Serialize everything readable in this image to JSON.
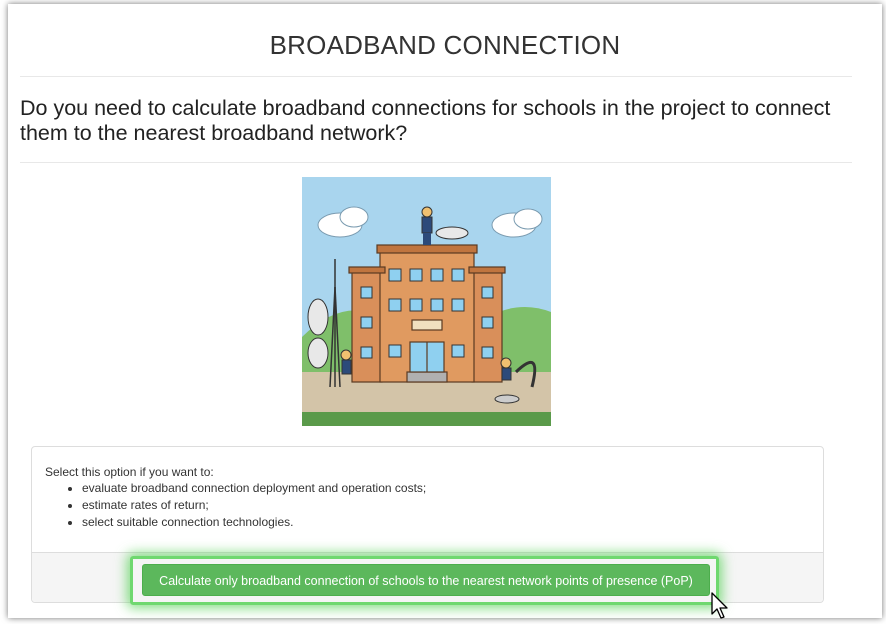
{
  "page": {
    "title": "BROADBAND CONNECTION",
    "question": "Do you need to calculate broadband connections for schools in the project to connect them to the nearest broadband network?"
  },
  "illustration": {
    "icon": "school-building-broadband-illustration"
  },
  "panel": {
    "intro": "Select this option if you want to:",
    "items": [
      "evaluate broadband connection deployment and operation costs;",
      "estimate rates of return;",
      "select suitable connection technologies."
    ]
  },
  "action": {
    "label": "Calculate only broadband connection of schools to the nearest network points of presence (PoP)"
  },
  "colors": {
    "button": "#5cb85c",
    "highlight": "#6fd86f",
    "text": "#333333"
  }
}
